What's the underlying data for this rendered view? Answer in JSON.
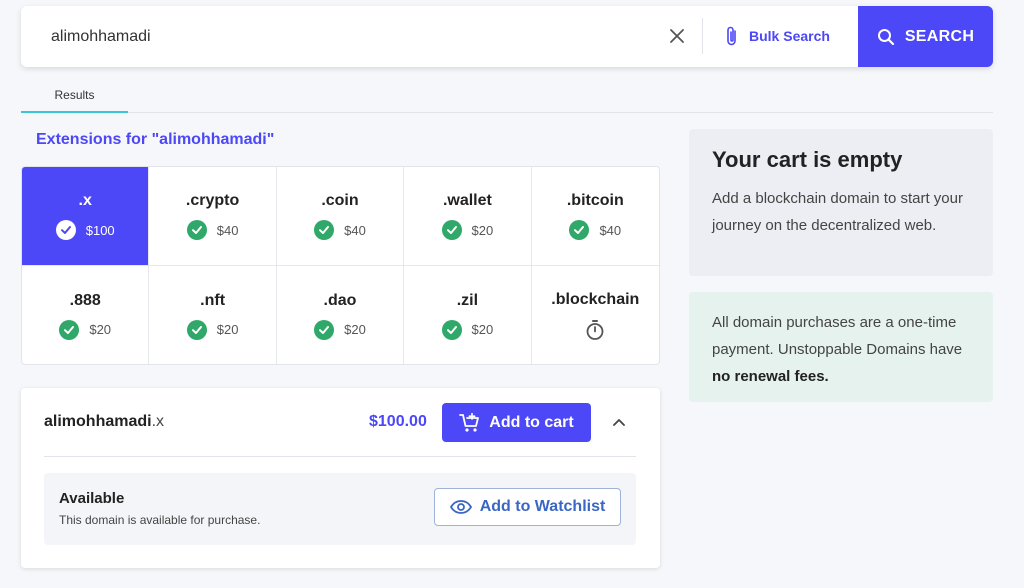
{
  "search": {
    "value": "alimohhamadi",
    "bulk_label": "Bulk Search",
    "button_label": "SEARCH"
  },
  "tabs": [
    {
      "label": "Results",
      "active": true
    }
  ],
  "extensions_heading": "Extensions for \"alimohhamadi\"",
  "extensions": [
    {
      "name": ".x",
      "price": "$100",
      "status": "available",
      "selected": true
    },
    {
      "name": ".crypto",
      "price": "$40",
      "status": "available"
    },
    {
      "name": ".coin",
      "price": "$40",
      "status": "available"
    },
    {
      "name": ".wallet",
      "price": "$20",
      "status": "available"
    },
    {
      "name": ".bitcoin",
      "price": "$40",
      "status": "available"
    },
    {
      "name": ".888",
      "price": "$20",
      "status": "available"
    },
    {
      "name": ".nft",
      "price": "$20",
      "status": "available"
    },
    {
      "name": ".dao",
      "price": "$20",
      "status": "available"
    },
    {
      "name": ".zil",
      "price": "$20",
      "status": "available"
    },
    {
      "name": ".blockchain",
      "price": "",
      "status": "pending"
    }
  ],
  "domain": {
    "base": "alimohhamadi",
    "ext": ".x",
    "price": "$100.00",
    "add_to_cart": "Add to cart",
    "availability_title": "Available",
    "availability_text": "This domain is available for purchase.",
    "watchlist_label": "Add to Watchlist"
  },
  "cart": {
    "title": "Your cart is empty",
    "description": "Add a blockchain domain to start your journey on the decentralized web."
  },
  "info": {
    "text": "All domain purchases are a one-time payment. Unstoppable Domains have ",
    "bold": "no renewal fees."
  },
  "colors": {
    "accent": "#4c47f7",
    "success": "#2fa86a",
    "tab_underline": "#38c6d6"
  }
}
